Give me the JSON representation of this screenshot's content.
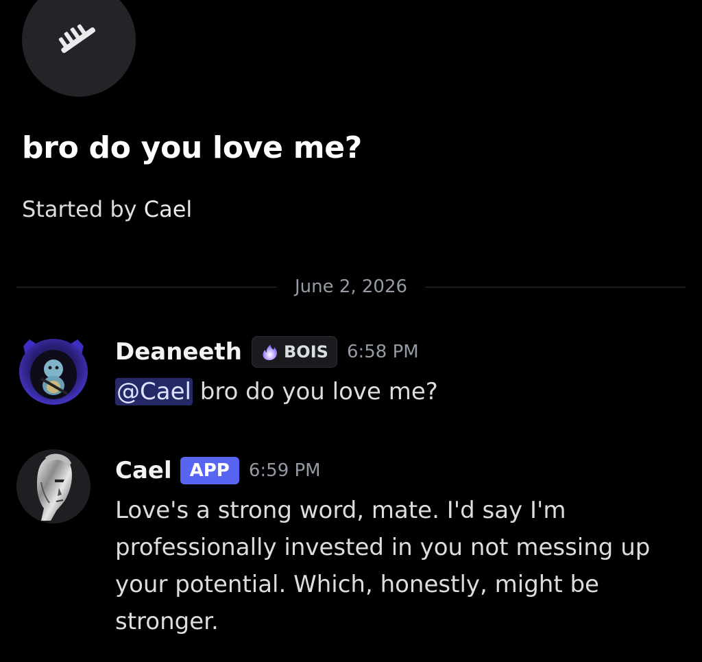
{
  "colors": {
    "background": "#000000",
    "app_badge": "#5865f2",
    "mention_bg": "#3b428a",
    "muted_text": "#949ba4",
    "divider": "#2e3035"
  },
  "thread": {
    "icon": "thread-icon",
    "title": "bro do you love me?",
    "started_by_prefix": "Started by",
    "started_by_author": "Cael"
  },
  "divider": {
    "date": "June 2, 2026"
  },
  "messages": [
    {
      "author": "Deaneeth",
      "avatar": "hooded-squirtle-avatar",
      "tag": {
        "icon": "purple-flame-icon",
        "label": "BOIS"
      },
      "timestamp": "6:58 PM",
      "mention": "@Cael",
      "text": " bro do you love me?"
    },
    {
      "author": "Cael",
      "avatar": "chrome-face-avatar",
      "badge": "APP",
      "timestamp": "6:59 PM",
      "lines": [
        "Love's a strong word, mate. I'd say I'm",
        "professionally invested in you not messing up",
        "your potential. Which, honestly, might be",
        "stronger."
      ]
    }
  ]
}
